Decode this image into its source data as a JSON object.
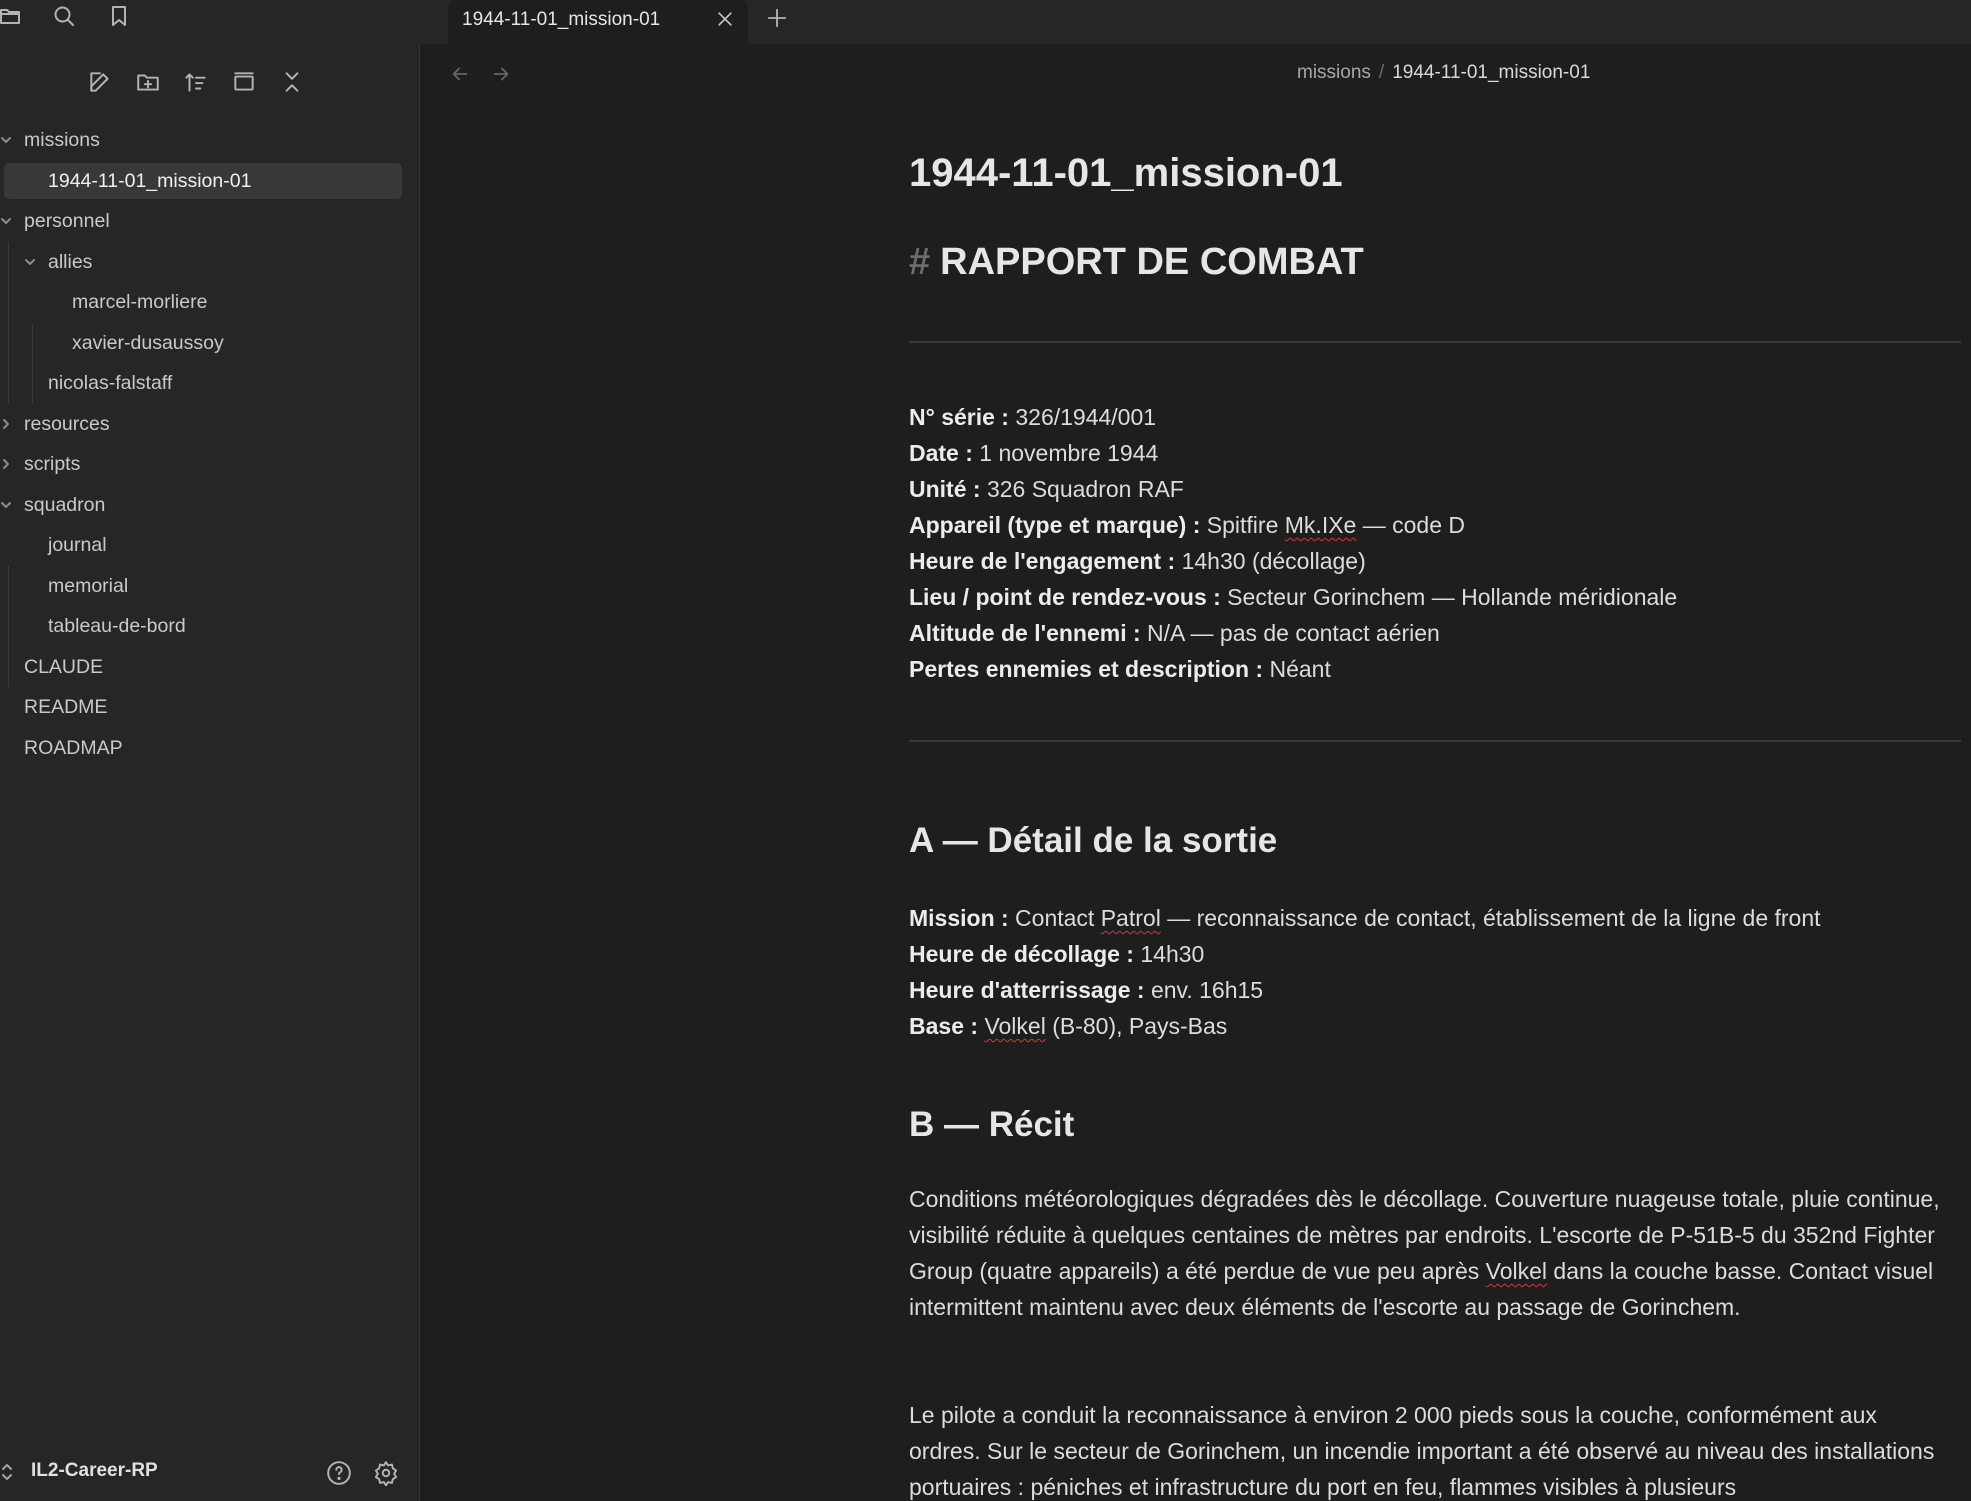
{
  "tabbar": {
    "active_tab_title": "1944-11-01_mission-01"
  },
  "sidebar": {
    "tree": [
      {
        "label": "missions",
        "depth": 0,
        "type": "folder",
        "state": "open"
      },
      {
        "label": "1944-11-01_mission-01",
        "depth": 1,
        "type": "file",
        "active": true
      },
      {
        "label": "personnel",
        "depth": 0,
        "type": "folder",
        "state": "open"
      },
      {
        "label": "allies",
        "depth": 1,
        "type": "folder",
        "state": "open"
      },
      {
        "label": "marcel-morliere",
        "depth": 2,
        "type": "file"
      },
      {
        "label": "xavier-dusaussoy",
        "depth": 2,
        "type": "file"
      },
      {
        "label": "nicolas-falstaff",
        "depth": 1,
        "type": "file"
      },
      {
        "label": "resources",
        "depth": 0,
        "type": "folder",
        "state": "closed"
      },
      {
        "label": "scripts",
        "depth": 0,
        "type": "folder",
        "state": "closed"
      },
      {
        "label": "squadron",
        "depth": 0,
        "type": "folder",
        "state": "open"
      },
      {
        "label": "journal",
        "depth": 1,
        "type": "file"
      },
      {
        "label": "memorial",
        "depth": 1,
        "type": "file"
      },
      {
        "label": "tableau-de-bord",
        "depth": 1,
        "type": "file"
      },
      {
        "label": "CLAUDE",
        "depth": 0,
        "type": "file"
      },
      {
        "label": "README",
        "depth": 0,
        "type": "file"
      },
      {
        "label": "ROADMAP",
        "depth": 0,
        "type": "file"
      }
    ],
    "vault_name": "IL2-Career-RP"
  },
  "main": {
    "breadcrumb": {
      "folder": "missions",
      "separator": "/",
      "current": "1944-11-01_mission-01"
    },
    "inline_title": "1944-11-01_mission-01",
    "h1_hash": "#",
    "h1": "RAPPORT DE COMBAT",
    "fields": [
      {
        "label": "N° série :",
        "value": " 326/1944/001"
      },
      {
        "label": "Date :",
        "value": " 1 novembre 1944"
      },
      {
        "label": "Unité :",
        "value": " 326 Squadron RAF"
      },
      {
        "label": "Appareil (type et marque) :",
        "value_pre": " Spitfire ",
        "value_sq": "Mk.IXe",
        "value_post": " — code D"
      },
      {
        "label": "Heure de l'engagement :",
        "value": " 14h30 (décollage)"
      },
      {
        "label": "Lieu / point de rendez-vous :",
        "value": " Secteur Gorinchem — Hollande méridionale"
      },
      {
        "label": "Altitude de l'ennemi :",
        "value": " N/A — pas de contact aérien"
      },
      {
        "label": "Pertes ennemies et description :",
        "value": " Néant"
      }
    ],
    "section_a": {
      "title": "A — Détail de la sortie",
      "fields": [
        {
          "label": "Mission :",
          "value_pre": " Contact ",
          "value_sq": "Patrol",
          "value_post": " — reconnaissance de contact, établissement de la ligne de front"
        },
        {
          "label": "Heure de décollage :",
          "value": " 14h30"
        },
        {
          "label": "Heure d'atterrissage :",
          "value": " env. 16h15"
        },
        {
          "label": "Base :",
          "value_pre": " ",
          "value_sq": "Volkel",
          "value_post": " (B-80), Pays-Bas"
        }
      ]
    },
    "section_b": {
      "title": "B — Récit",
      "para1_pre": "Conditions météorologiques dégradées dès le décollage. Couverture nuageuse totale, pluie continue, visibilité réduite à quelques centaines de mètres par endroits. L'escorte de P-51B-5 du 352nd Fighter Group (quatre appareils) a été perdue de vue peu après ",
      "para1_sq": "Volkel",
      "para1_post": " dans la couche basse. Contact visuel intermittent maintenu avec deux éléments de l'escorte au passage de Gorinchem.",
      "para2": "Le pilote a conduit la reconnaissance à environ 2 000 pieds sous la couche, conformément aux ordres. Sur le secteur de Gorinchem, un incendie important a été observé au niveau des installations portuaires : péniches et infrastructure du port en feu, flammes visibles à plusieurs"
    }
  }
}
